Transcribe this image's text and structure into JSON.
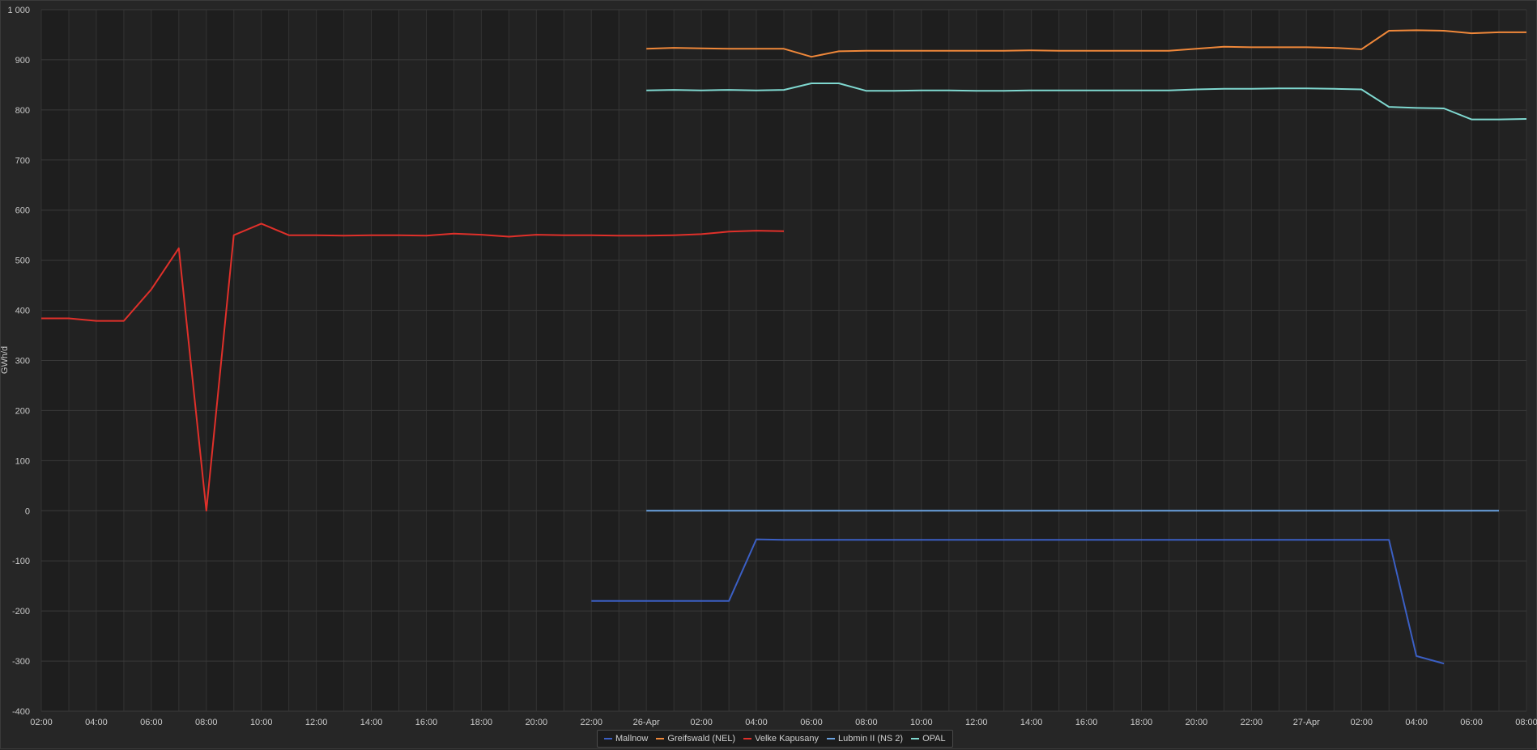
{
  "chart_data": {
    "type": "line",
    "title": "",
    "xlabel": "",
    "ylabel": "GWh/d",
    "ylim": [
      -400,
      1000
    ],
    "yticks": [
      -400,
      -300,
      -200,
      -100,
      0,
      100,
      200,
      300,
      400,
      500,
      600,
      700,
      800,
      900,
      1000
    ],
    "ytick_labels": [
      "-400",
      "-300",
      "-200",
      "-100",
      "0",
      "100",
      "200",
      "300",
      "400",
      "500",
      "600",
      "700",
      "800",
      "900",
      "1 000"
    ],
    "x_unit": "hours since first tick (25-Apr 02:00)",
    "xlim": [
      0,
      54
    ],
    "xticks": [
      0,
      2,
      4,
      6,
      8,
      10,
      12,
      14,
      16,
      18,
      20,
      22,
      24,
      26,
      28,
      30,
      32,
      34,
      36,
      38,
      40,
      42,
      44,
      46,
      48,
      50,
      52,
      54
    ],
    "xtick_labels": [
      "02:00",
      "04:00",
      "06:00",
      "08:00",
      "10:00",
      "12:00",
      "14:00",
      "16:00",
      "18:00",
      "20:00",
      "22:00",
      "26-Apr",
      "02:00",
      "04:00",
      "06:00",
      "08:00",
      "10:00",
      "12:00",
      "14:00",
      "16:00",
      "18:00",
      "20:00",
      "22:00",
      "27-Apr",
      "02:00",
      "04:00",
      "06:00",
      "08:00"
    ],
    "grid": true,
    "legend_position": "bottom-center",
    "series": [
      {
        "name": "Mallnow",
        "color": "#3b5fc4",
        "x": [
          20,
          21,
          22,
          23,
          24,
          25,
          26,
          27,
          28,
          29,
          30,
          31,
          32,
          33,
          34,
          35,
          36,
          37,
          38,
          39,
          40,
          41,
          42,
          43,
          44,
          45,
          46,
          47,
          48,
          49,
          50,
          51
        ],
        "y": [
          -180,
          -180,
          -180,
          -180,
          -180,
          -180,
          -57,
          -58,
          -58,
          -58,
          -58,
          -58,
          -58,
          -58,
          -58,
          -58,
          -58,
          -58,
          -58,
          -58,
          -58,
          -58,
          -58,
          -58,
          -58,
          -58,
          -58,
          -58,
          -58,
          -58,
          -290,
          -305
        ]
      },
      {
        "name": "Greifswald (NEL)",
        "color": "#f0883a",
        "x": [
          22,
          23,
          24,
          25,
          26,
          27,
          28,
          29,
          30,
          31,
          32,
          33,
          34,
          35,
          36,
          37,
          38,
          39,
          40,
          41,
          42,
          43,
          44,
          45,
          46,
          47,
          48,
          49,
          50,
          51,
          52,
          53,
          54
        ],
        "y": [
          922,
          924,
          923,
          922,
          922,
          922,
          906,
          917,
          918,
          918,
          918,
          918,
          918,
          918,
          919,
          918,
          918,
          918,
          918,
          918,
          922,
          926,
          925,
          925,
          925,
          924,
          921,
          958,
          959,
          958,
          953,
          955,
          955
        ]
      },
      {
        "name": "Velke Kapusany",
        "color": "#e0302a",
        "x": [
          0,
          1,
          2,
          3,
          4,
          5,
          6,
          7,
          8,
          9,
          10,
          11,
          12,
          13,
          14,
          15,
          16,
          17,
          18,
          19,
          20,
          21,
          22,
          23,
          24,
          25,
          26,
          27
        ],
        "y": [
          384,
          384,
          379,
          379,
          442,
          524,
          0,
          550,
          573,
          550,
          550,
          549,
          550,
          550,
          549,
          553,
          551,
          547,
          551,
          550,
          550,
          549,
          549,
          550,
          552,
          557,
          559,
          558
        ]
      },
      {
        "name": "Lubmin II (NS 2)",
        "color": "#6aa2e0",
        "x": [
          22,
          53
        ],
        "y": [
          0,
          0
        ]
      },
      {
        "name": "OPAL",
        "color": "#7fd8d0",
        "x": [
          22,
          23,
          24,
          25,
          26,
          27,
          28,
          29,
          30,
          31,
          32,
          33,
          34,
          35,
          36,
          37,
          38,
          39,
          40,
          41,
          42,
          43,
          44,
          45,
          46,
          47,
          48,
          49,
          50,
          51,
          52,
          53,
          54
        ],
        "y": [
          839,
          840,
          839,
          840,
          839,
          840,
          853,
          853,
          838,
          838,
          839,
          839,
          838,
          838,
          839,
          839,
          839,
          839,
          839,
          839,
          841,
          842,
          842,
          843,
          843,
          842,
          841,
          806,
          804,
          803,
          781,
          781,
          782
        ]
      }
    ]
  }
}
